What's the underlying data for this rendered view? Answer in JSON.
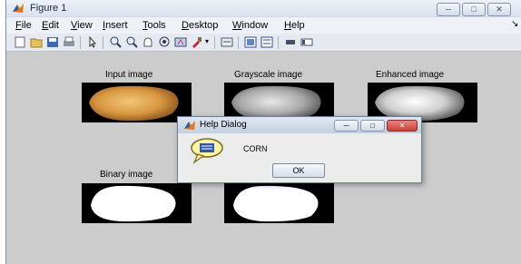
{
  "window": {
    "title": "Figure 1"
  },
  "menu": {
    "items": [
      "File",
      "Edit",
      "View",
      "Insert",
      "Tools",
      "Desktop",
      "Window",
      "Help"
    ]
  },
  "toolbar": {
    "icons": [
      "new-figure-icon",
      "open-file-icon",
      "save-icon",
      "print-icon",
      "select-arrow-icon",
      "zoom-in-icon",
      "zoom-out-icon",
      "pan-icon",
      "rotate-icon",
      "data-cursor-icon",
      "brush-icon",
      "link-icon",
      "colorbar-icon",
      "legend-icon",
      "hide-plot-tools-icon",
      "show-plot-tools-icon"
    ]
  },
  "axes": [
    {
      "title": "Input image"
    },
    {
      "title": "Grayscale image"
    },
    {
      "title": "Enhanced image"
    },
    {
      "title": "Binary image"
    },
    {
      "title": ""
    }
  ],
  "dialog": {
    "title": "Help Dialog",
    "message": "CORN",
    "ok_label": "OK"
  },
  "colors": {
    "titlebar": "#dfe6f0",
    "figure_bg": "#cccccc",
    "close_red": "#c9413a"
  }
}
